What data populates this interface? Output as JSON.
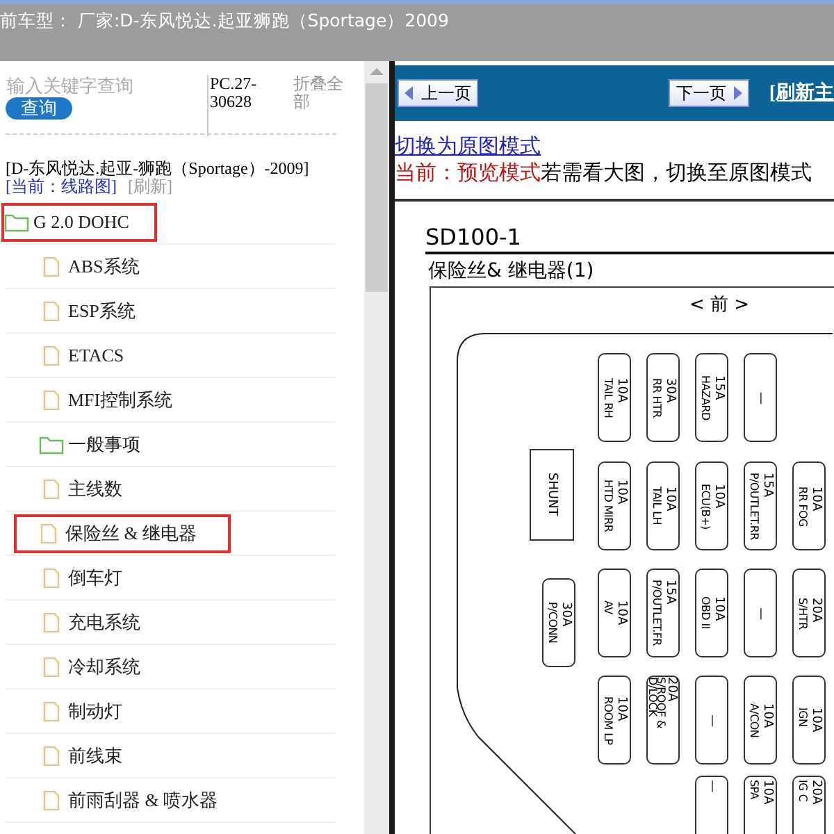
{
  "header": {
    "title": "前车型： 厂家:D-东风悦达.起亚狮跑（Sportage）2009"
  },
  "sidebar": {
    "search": {
      "placeholder": "输入关键字查询",
      "button": "查询"
    },
    "code": "PC.27-30628",
    "collapse_all": "折叠全部",
    "vehicle": "[D-东风悦达.起亚-狮跑（Sportage）-2009]",
    "current": "[当前：线路图]",
    "refresh": "[刷新]",
    "tree": [
      {
        "label": "G 2.0 DOHC",
        "kind": "folder",
        "highlighted": true,
        "children": [
          {
            "label": "ABS系统",
            "kind": "file",
            "highlighted": false
          },
          {
            "label": "ESP系统",
            "kind": "file",
            "highlighted": false
          },
          {
            "label": "ETACS",
            "kind": "file",
            "highlighted": false
          },
          {
            "label": "MFI控制系统",
            "kind": "file",
            "highlighted": false
          },
          {
            "label": "一般事项",
            "kind": "folder",
            "highlighted": false
          },
          {
            "label": "主线数",
            "kind": "file",
            "highlighted": false
          },
          {
            "label": "保险丝 & 继电器",
            "kind": "file",
            "highlighted": true
          },
          {
            "label": "倒车灯",
            "kind": "file",
            "highlighted": false
          },
          {
            "label": "充电系统",
            "kind": "file",
            "highlighted": false
          },
          {
            "label": "冷却系统",
            "kind": "file",
            "highlighted": false
          },
          {
            "label": "制动灯",
            "kind": "file",
            "highlighted": false
          },
          {
            "label": "前线束",
            "kind": "file",
            "highlighted": false
          },
          {
            "label": "前雨刮器 & 喷水器",
            "kind": "file",
            "highlighted": false
          }
        ]
      }
    ]
  },
  "toolbar": {
    "prev": "上一页",
    "next": "下一页",
    "refresh": "[刷新主"
  },
  "mode": {
    "switch_link": "切换为原图模式",
    "current": "当前：预览模式",
    "hint": "若需看大图，切换至原图模式"
  },
  "document": {
    "code": "SD100-1",
    "title": "保险丝& 继电器(1)",
    "front": "< 前 >",
    "shunt": "SHUNT",
    "side_fuse": [
      "30A",
      "P/CONN"
    ],
    "fuse_rows": [
      [
        {
          "kind": "fuse",
          "lines": [
            "10A",
            "TAIL RH"
          ]
        },
        {
          "kind": "fuse",
          "lines": [
            "30A",
            "RR HTR"
          ]
        },
        {
          "kind": "fuse",
          "lines": [
            "15A",
            "HAZARD"
          ]
        },
        {
          "kind": "fuse",
          "lines": [
            "—"
          ]
        },
        {
          "kind": "empty"
        }
      ],
      [
        {
          "kind": "fuse",
          "lines": [
            "10A",
            "HTD MIRR"
          ]
        },
        {
          "kind": "fuse",
          "lines": [
            "10A",
            "TAIL LH"
          ]
        },
        {
          "kind": "fuse",
          "lines": [
            "10A",
            "ECU(B+)"
          ]
        },
        {
          "kind": "fuse",
          "lines": [
            "15A",
            "P/OUTLET.RR"
          ]
        },
        {
          "kind": "fuse",
          "lines": [
            "10A",
            "RR FOG"
          ]
        }
      ],
      [
        {
          "kind": "fuse",
          "lines": [
            "10A",
            "AV"
          ]
        },
        {
          "kind": "fuse",
          "lines": [
            "15A",
            "P/OUTLET.FR"
          ]
        },
        {
          "kind": "fuse",
          "lines": [
            "10A",
            "OBD II"
          ]
        },
        {
          "kind": "fuse",
          "lines": [
            "—"
          ]
        },
        {
          "kind": "fuse",
          "lines": [
            "20A",
            "S/HTR"
          ]
        }
      ],
      [
        {
          "kind": "fuse",
          "lines": [
            "10A",
            "ROOM LP"
          ]
        },
        {
          "kind": "fuse",
          "lines": [
            "20A",
            "S/ROOF & D/LOCK"
          ]
        },
        {
          "kind": "fuse",
          "lines": [
            "—"
          ]
        },
        {
          "kind": "fuse",
          "lines": [
            "10A",
            "A/CON"
          ]
        },
        {
          "kind": "fuse",
          "lines": [
            "10A",
            "IGN"
          ]
        }
      ],
      [
        {
          "kind": "empty"
        },
        {
          "kind": "empty"
        },
        {
          "kind": "fuse",
          "lines": [
            "—"
          ]
        },
        {
          "kind": "fuse",
          "lines": [
            "10A",
            "SPA"
          ]
        },
        {
          "kind": "fuse",
          "lines": [
            "20A",
            "IG C"
          ]
        }
      ]
    ]
  }
}
